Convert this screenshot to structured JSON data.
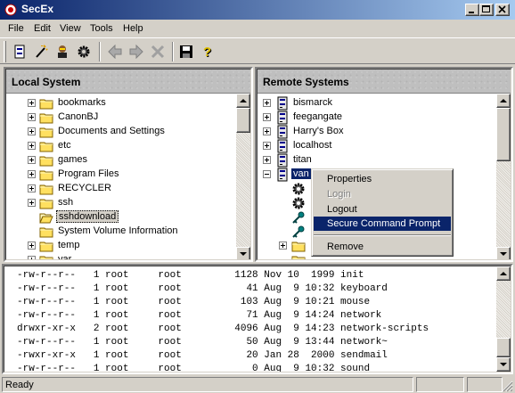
{
  "window": {
    "title": "SecEx"
  },
  "menu": [
    "File",
    "Edit",
    "View",
    "Tools",
    "Help"
  ],
  "toolbar": {
    "buttons": [
      "connect-icon",
      "wizard-icon",
      "user-icon",
      "gear-icon",
      "back-arrow-icon",
      "forward-arrow-icon",
      "close-icon",
      "save-icon",
      "help-icon"
    ]
  },
  "local": {
    "header": "Local System",
    "items": [
      {
        "label": "bookmarks",
        "expandable": true
      },
      {
        "label": "CanonBJ",
        "expandable": true
      },
      {
        "label": "Documents and Settings",
        "expandable": true
      },
      {
        "label": "etc",
        "expandable": true
      },
      {
        "label": "games",
        "expandable": true
      },
      {
        "label": "Program Files",
        "expandable": true
      },
      {
        "label": "RECYCLER",
        "expandable": true
      },
      {
        "label": "ssh",
        "expandable": true
      },
      {
        "label": "sshdownload",
        "expandable": false,
        "selected": true
      },
      {
        "label": "System Volume Information",
        "expandable": false
      },
      {
        "label": "temp",
        "expandable": true
      },
      {
        "label": "var",
        "expandable": true
      }
    ]
  },
  "remote": {
    "header": "Remote Systems",
    "items": [
      {
        "label": "bismarck"
      },
      {
        "label": "feegangate"
      },
      {
        "label": "Harry's Box"
      },
      {
        "label": "localhost"
      },
      {
        "label": "titan"
      },
      {
        "label": "van"
      }
    ]
  },
  "context_menu": {
    "items": [
      {
        "label": "Properties",
        "state": "normal"
      },
      {
        "label": "Login",
        "state": "disabled"
      },
      {
        "label": "Logout",
        "state": "normal"
      },
      {
        "label": "Secure Command Prompt",
        "state": "highlighted"
      },
      {
        "label": "Remove",
        "state": "normal"
      }
    ]
  },
  "terminal": {
    "lines": [
      "-rw-r--r--   1 root     root         1128 Nov 10  1999 init",
      "-rw-r--r--   1 root     root           41 Aug  9 10:32 keyboard",
      "-rw-r--r--   1 root     root          103 Aug  9 10:21 mouse",
      "-rw-r--r--   1 root     root           71 Aug  9 14:24 network",
      "drwxr-xr-x   2 root     root         4096 Aug  9 14:23 network-scripts",
      "-rw-r--r--   1 root     root           50 Aug  9 13:44 network~",
      "-rwxr-xr-x   1 root     root           20 Jan 28  2000 sendmail",
      "-rw-r--r--   1 root     root            0 Aug  9 10:32 sound"
    ]
  },
  "status": {
    "text": "Ready"
  },
  "colors": {
    "titlebar": "#0a246a",
    "highlight": "#0a246a",
    "face": "#d4d0c8"
  }
}
